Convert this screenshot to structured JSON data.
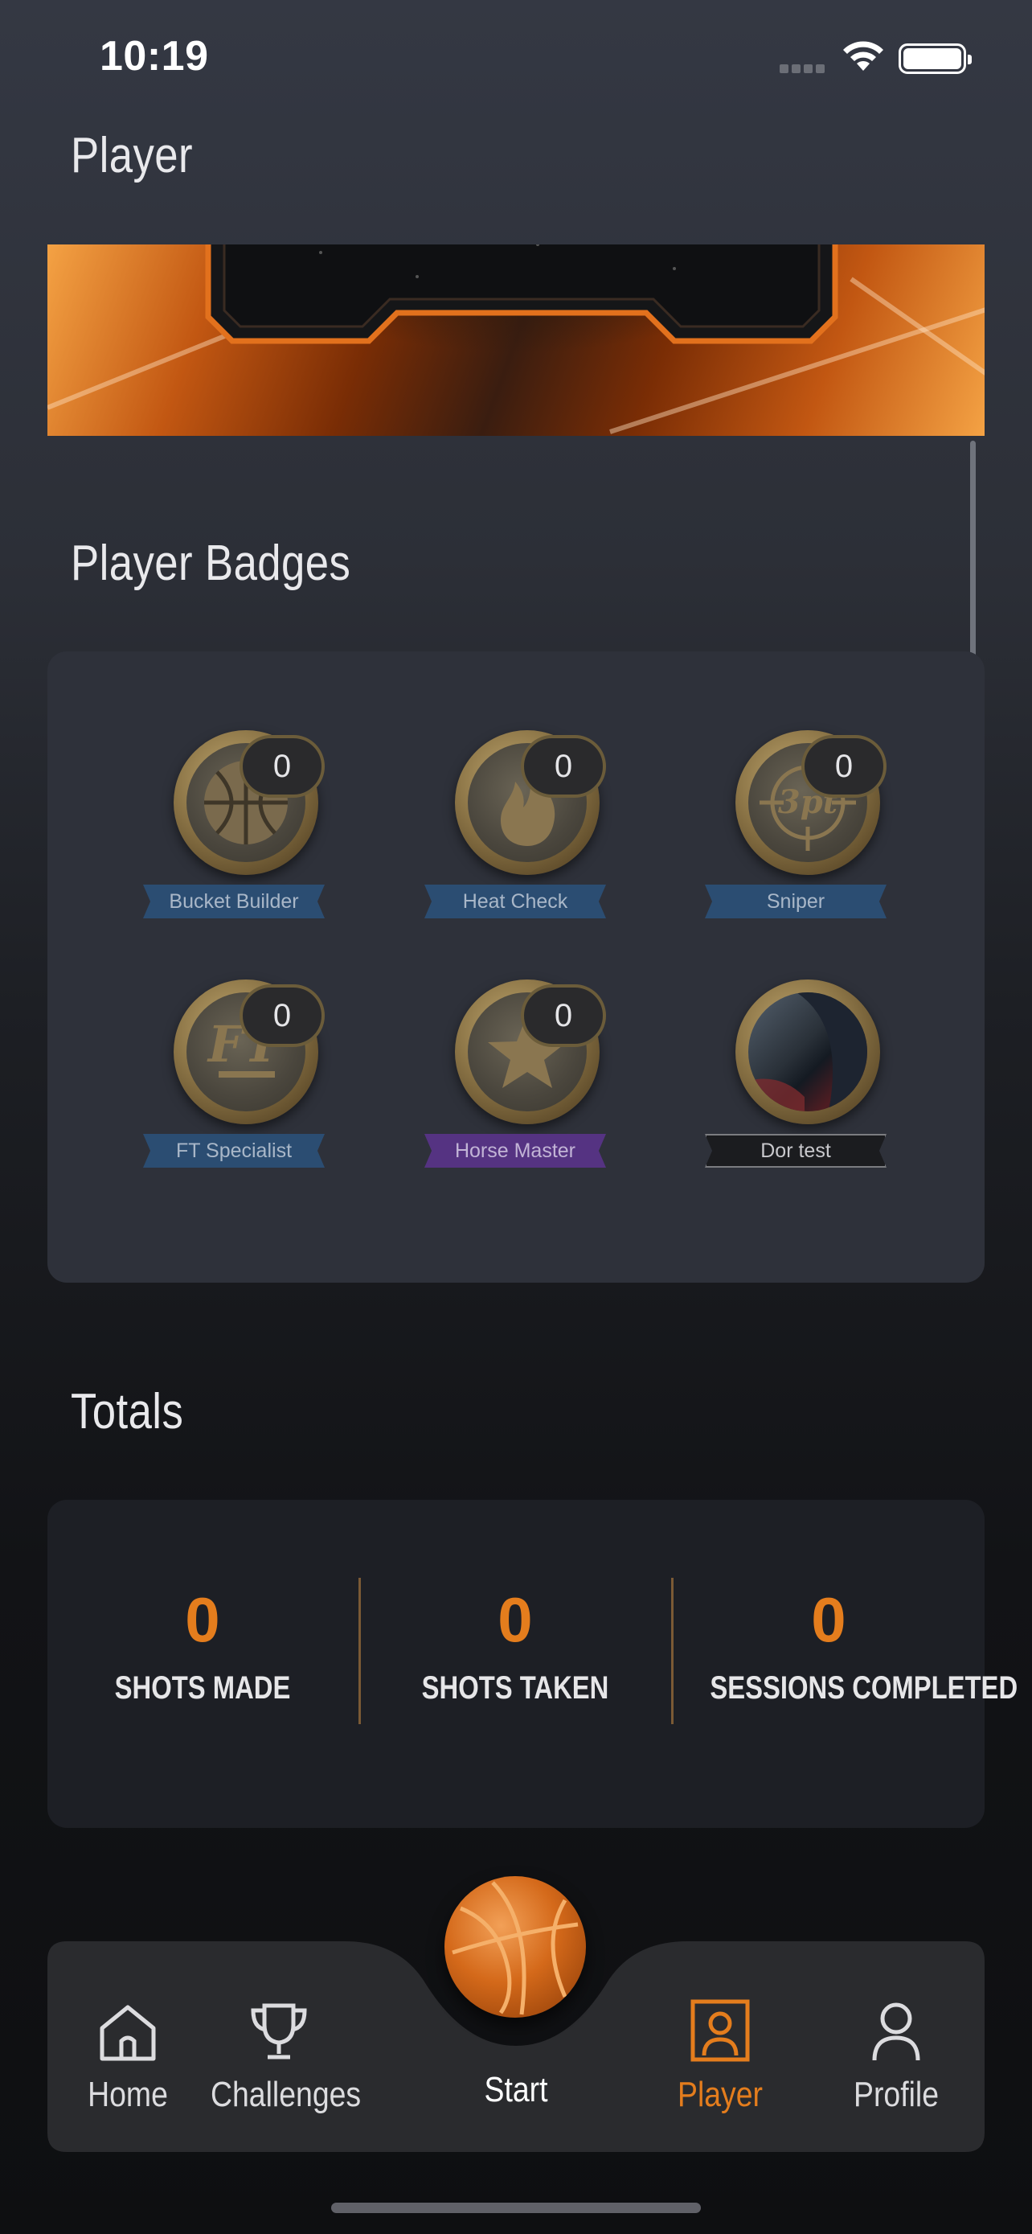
{
  "status": {
    "time": "10:19"
  },
  "page": {
    "title": "Player"
  },
  "badges_section": {
    "title": "Player Badges",
    "badges": [
      {
        "name": "Bucket Builder",
        "count": "0",
        "ribbon": "blue",
        "icon": "basketball-icon"
      },
      {
        "name": "Heat Check",
        "count": "0",
        "ribbon": "blue",
        "icon": "flame-icon"
      },
      {
        "name": "Sniper",
        "count": "0",
        "ribbon": "blue",
        "icon": "3pt-crosshair-icon"
      },
      {
        "name": "FT Specialist",
        "count": "0",
        "ribbon": "blue",
        "icon": "ft-icon"
      },
      {
        "name": "Horse Master",
        "count": "0",
        "ribbon": "purple",
        "icon": "star-icon"
      },
      {
        "name": "Dor test",
        "ribbon": "dark",
        "icon": "custom-image-icon"
      }
    ]
  },
  "totals_section": {
    "title": "Totals",
    "stats": [
      {
        "value": "0",
        "label": "SHOTS MADE"
      },
      {
        "value": "0",
        "label": "SHOTS TAKEN"
      },
      {
        "value": "0",
        "label": "SESSIONS COMPLETED"
      }
    ]
  },
  "tabbar": {
    "items": [
      {
        "label": "Home",
        "icon": "home-icon"
      },
      {
        "label": "Challenges",
        "icon": "trophy-icon"
      },
      {
        "label": "Start",
        "icon": "basketball-icon"
      },
      {
        "label": "Player",
        "icon": "player-card-icon",
        "active": true
      },
      {
        "label": "Profile",
        "icon": "person-icon"
      }
    ]
  },
  "colors": {
    "accent": "#e47d1d",
    "ribbon_blue": "#2b4d72",
    "ribbon_purple": "#553382"
  }
}
